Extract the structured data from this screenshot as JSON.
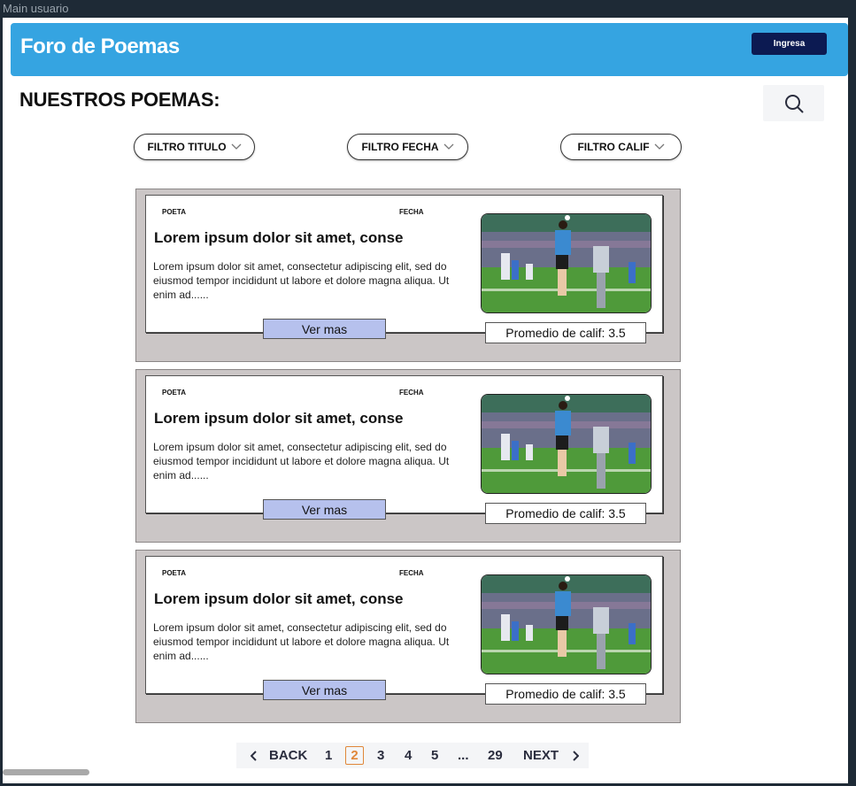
{
  "frame": {
    "label": "Main usuario"
  },
  "header": {
    "brand": "Foro de Poemas",
    "login_label": "Ingresa"
  },
  "page": {
    "title": "NUESTROS POEMAS:"
  },
  "filters": [
    {
      "label": "FILTRO TITULO"
    },
    {
      "label": "FILTRO FECHA"
    },
    {
      "label": "FILTRO CALIF"
    }
  ],
  "poems": [
    {
      "poeta_label": "POETA",
      "fecha_label": "FECHA",
      "title": "Lorem ipsum dolor sit amet, conse",
      "excerpt": "Lorem ipsum dolor sit amet, consectetur adipiscing elit, sed do eiusmod tempor incididunt ut labore et dolore magna aliqua. Ut enim ad......",
      "button_label": "Ver mas",
      "rating_text": "Promedio de calif: 3.5"
    },
    {
      "poeta_label": "POETA",
      "fecha_label": "FECHA",
      "title": "Lorem ipsum dolor sit amet, conse",
      "excerpt": "Lorem ipsum dolor sit amet, consectetur adipiscing elit, sed do eiusmod tempor incididunt ut labore et dolore magna aliqua. Ut enim ad......",
      "button_label": "Ver mas",
      "rating_text": "Promedio de calif: 3.5"
    },
    {
      "poeta_label": "POETA",
      "fecha_label": "FECHA",
      "title": "Lorem ipsum dolor sit amet, conse",
      "excerpt": "Lorem ipsum dolor sit amet, consectetur adipiscing elit, sed do eiusmod tempor incididunt ut labore et dolore magna aliqua. Ut enim ad......",
      "button_label": "Ver mas",
      "rating_text": "Promedio de calif: 3.5"
    }
  ],
  "pagination": {
    "back_label": "BACK",
    "next_label": "NEXT",
    "pages": [
      "1",
      "2",
      "3",
      "4",
      "5",
      "...",
      "29"
    ],
    "current": "2"
  },
  "colors": {
    "header_bg": "#35a4e1",
    "login_bg": "#0c1a52",
    "card_bg": "#cbc6c6",
    "ver_mas_bg": "#b6c1ed",
    "current_page": "#e0873a"
  }
}
